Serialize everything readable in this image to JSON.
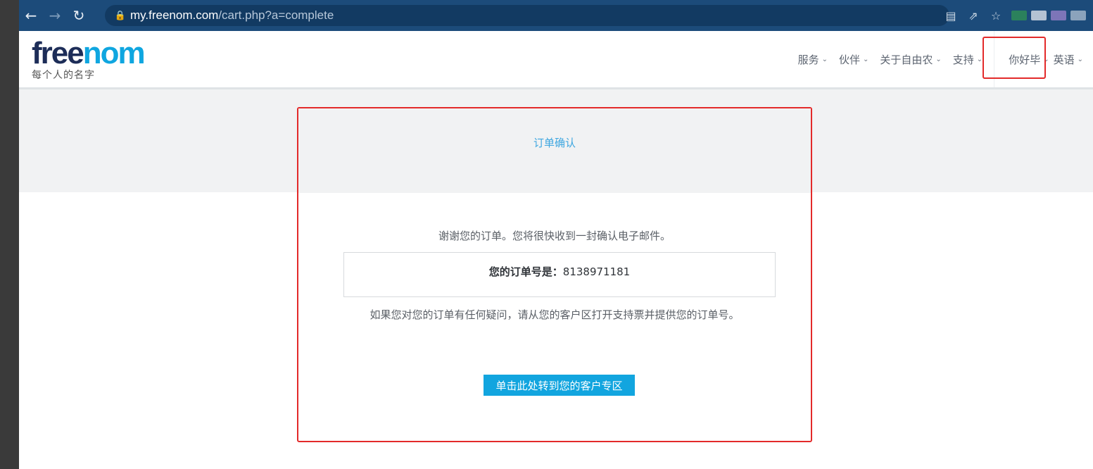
{
  "browser": {
    "url_host": "my.freenom.com",
    "url_path": "/cart.php?a=complete",
    "icons": [
      "back-arrow-icon",
      "forward-arrow-icon",
      "reload-icon",
      "lock-icon",
      "translate-icon",
      "share-icon",
      "star-icon"
    ],
    "profile_colors": [
      "#2e8b57",
      "#cfd8e3",
      "#8e7cc3",
      "#9fb3c8"
    ]
  },
  "header": {
    "logo": {
      "part1": "free",
      "part2": "nom",
      "tagline": "每个人的名字",
      "colors": {
        "dark": "#1d2d58",
        "blue": "#0fa6e0"
      }
    },
    "nav": [
      {
        "label": "服务"
      },
      {
        "label": "伙伴"
      },
      {
        "label": "关于自由农"
      },
      {
        "label": "支持"
      }
    ],
    "user_menu": "你好毕",
    "language": "英语"
  },
  "order": {
    "title": "订单确认",
    "thanks": "谢谢您的订单。您将很快收到一封确认电子邮件。",
    "number_label": "您的订单号是：",
    "number_value": "8138971181",
    "help_text": "如果您对您的订单有任何疑问，请从您的客户区打开支持票并提供您的订单号。",
    "client_button": "单击此处转到您的客户专区"
  },
  "colors": {
    "accent": "#12a5df",
    "highlight": "#e32a2a",
    "browser_bar": "#1c4b7a"
  }
}
